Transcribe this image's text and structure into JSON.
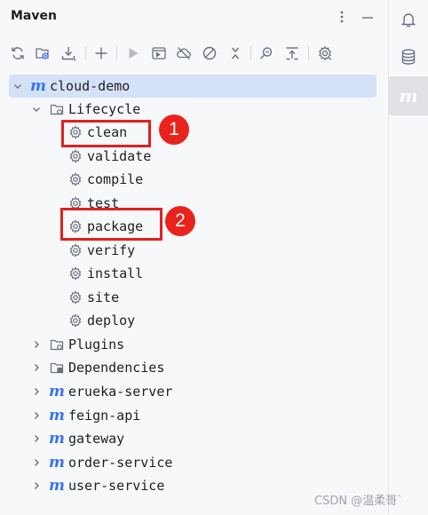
{
  "panel": {
    "title": "Maven",
    "options_icon": "vertical-ellipsis-icon",
    "minimize_icon": "minimize-icon"
  },
  "toolbar": {
    "icons": [
      "reload-icon",
      "add-project-icon",
      "download-icon",
      "plus-icon",
      "run-icon",
      "execute-goal-icon",
      "offline-icon",
      "skip-tests-icon",
      "collapse-icon",
      "analyze-dependencies-icon",
      "collapse-all-icon",
      "settings-icon"
    ]
  },
  "tree": {
    "root": "cloud-demo",
    "lifecycle": {
      "label": "Lifecycle",
      "goals": [
        "clean",
        "validate",
        "compile",
        "test",
        "package",
        "verify",
        "install",
        "site",
        "deploy"
      ]
    },
    "plugins": "Plugins",
    "dependencies": "Dependencies",
    "modules": [
      "erueka-server",
      "feign-api",
      "gateway",
      "order-service",
      "user-service"
    ]
  },
  "annotations": {
    "badge_1": "1",
    "badge_2": "2"
  },
  "sidebar": {
    "items": [
      "notifications-icon",
      "database-icon",
      "maven-icon"
    ]
  },
  "watermark": "CSDN @温柔哥`",
  "colors": {
    "accent": "#3574f0",
    "selection": "#d5e1f7",
    "highlight": "#e02020"
  }
}
